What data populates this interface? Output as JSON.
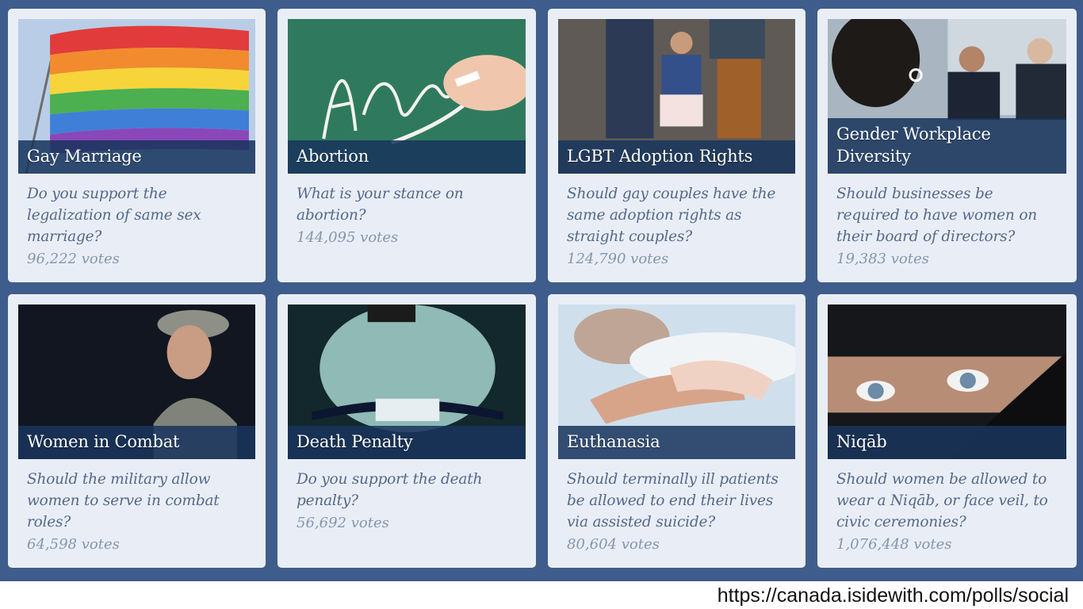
{
  "polls": [
    {
      "title": "Gay Marriage",
      "question": "Do you support the legalization of same sex marriage?",
      "votes": "96,222 votes",
      "image": "rainbow-flag-image"
    },
    {
      "title": "Abortion",
      "question": "What is your stance on abortion?",
      "votes": "144,095 votes",
      "image": "chalkboard-image"
    },
    {
      "title": "LGBT Adoption Rights",
      "question": "Should gay couples have the same adoption rights as straight couples?",
      "votes": "124,790 votes",
      "image": "family-walking-image"
    },
    {
      "title": "Gender Workplace Diversity",
      "question": "Should businesses be required to have women on their board of directors?",
      "votes": "19,383 votes",
      "image": "boardroom-image"
    },
    {
      "title": "Women in Combat",
      "question": "Should the military allow women to serve in combat roles?",
      "votes": "64,598 votes",
      "image": "female-soldier-image"
    },
    {
      "title": "Death Penalty",
      "question": "Do you support the death penalty?",
      "votes": "56,692 votes",
      "image": "execution-room-image"
    },
    {
      "title": "Euthanasia",
      "question": "Should terminally ill patients be allowed to end their lives via assisted suicide?",
      "votes": "80,604 votes",
      "image": "holding-hands-image"
    },
    {
      "title": "Niqāb",
      "question": "Should women be allowed to wear a Niqāb, or face veil, to civic ceremonies?",
      "votes": "1,076,448 votes",
      "image": "veiled-eyes-image"
    }
  ],
  "source_url": "https://canada.isidewith.com/polls/social",
  "colors": {
    "background": "#3f5d8c",
    "card": "#e9eef6",
    "caption": "#18345c"
  }
}
